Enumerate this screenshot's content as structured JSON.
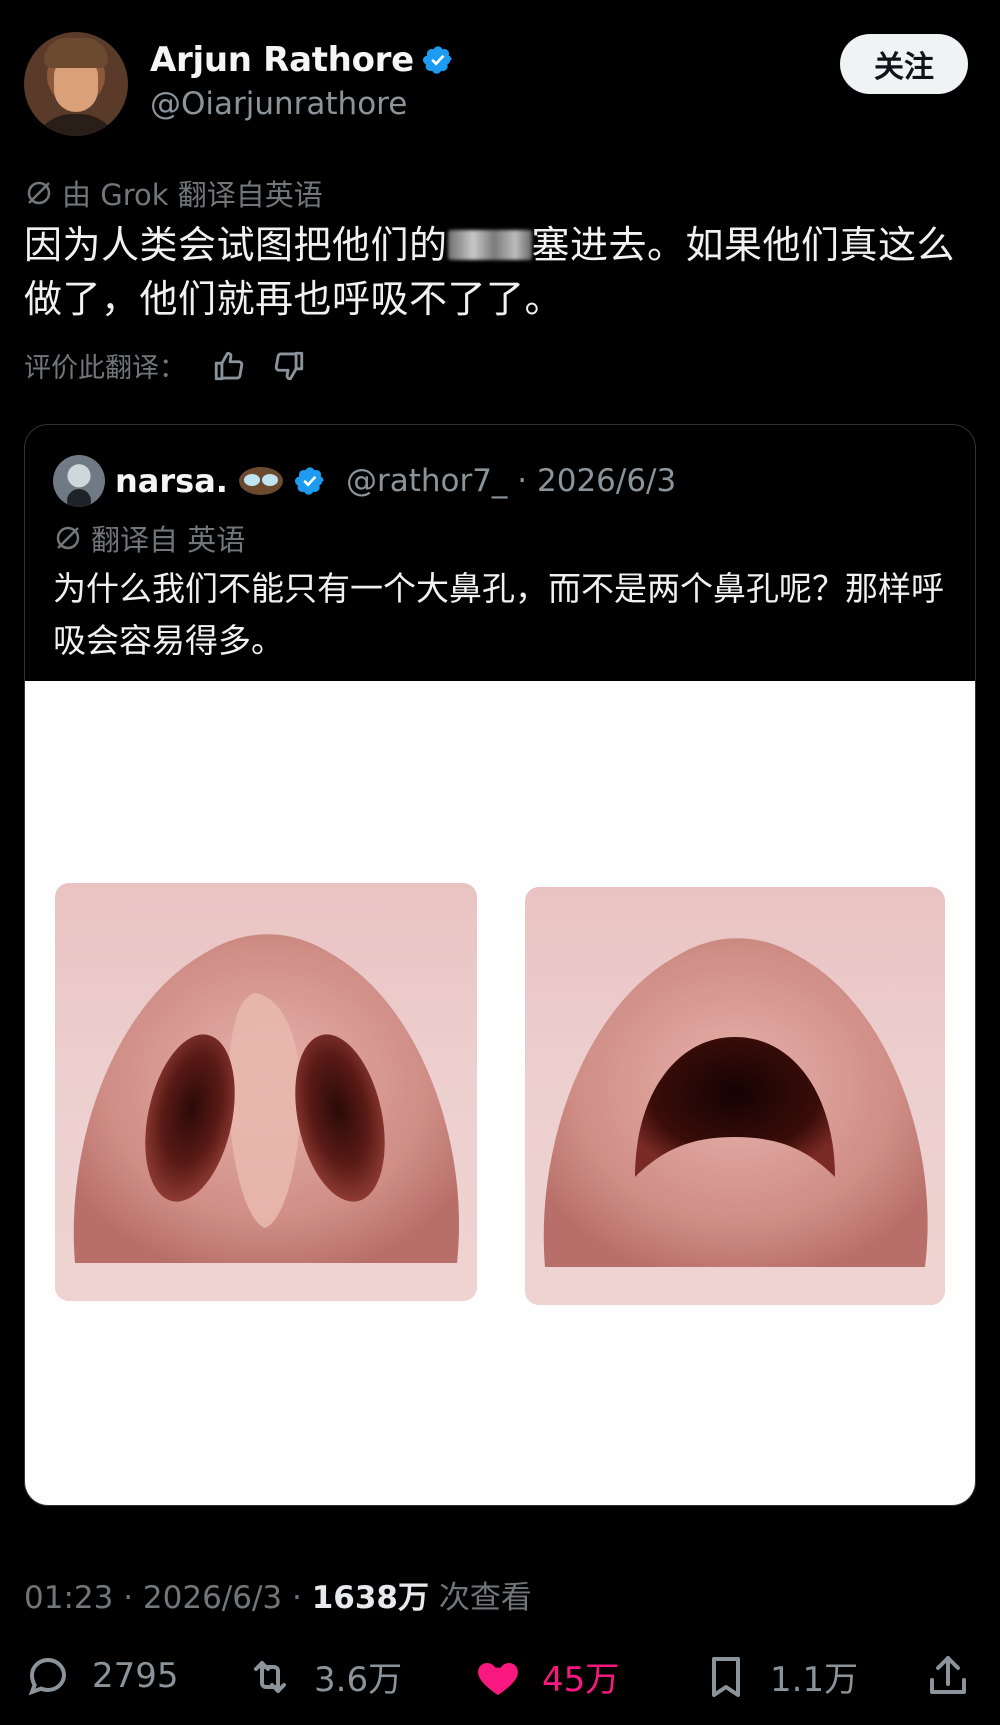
{
  "author": {
    "name": "Arjun Rathore",
    "handle": "@Oiarjunrathore",
    "follow_label": "关注"
  },
  "translation_note": "由 Grok 翻译自英语",
  "tweet_text_before": "因为人类会试图把他们的",
  "tweet_text_after": "塞进去。如果他们真这么做了，他们就再也呼吸不了了。",
  "rate_label": "评价此翻译：",
  "quote": {
    "name": "narsa.",
    "meta": "@rathor7_ · 2026/6/3",
    "translation_note": "翻译自 英语",
    "text": "为什么我们不能只有一个大鼻孔，而不是两个鼻孔呢？那样呼吸会容易得多。"
  },
  "timestamp": {
    "time_date": "01:23 · 2026/6/3 · ",
    "views": "1638万",
    "views_suffix": " 次查看"
  },
  "actions": {
    "reply_count": "2795",
    "retweet_count": "3.6万",
    "like_count": "45万",
    "bookmark_count": "1.1万"
  },
  "colors": {
    "background": "#000000",
    "verified_blue": "#1d9bf0",
    "like_pink": "#f91880",
    "muted_gray": "#71767b"
  },
  "icons": [
    "verified-badge-icon",
    "globe-slash-icon",
    "thumbs-up-icon",
    "thumbs-down-icon",
    "reply-icon",
    "retweet-icon",
    "heart-icon",
    "bookmark-icon",
    "share-icon"
  ]
}
